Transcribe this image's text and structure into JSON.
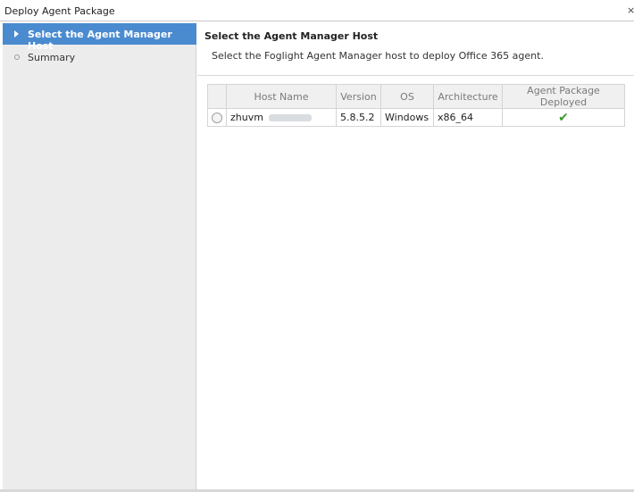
{
  "window": {
    "title": "Deploy Agent Package",
    "close_glyph": "×"
  },
  "steps": [
    {
      "label": "Select the Agent Manager Host",
      "active": true
    },
    {
      "label": "Summary",
      "active": false
    }
  ],
  "main": {
    "title": "Select the Agent Manager Host",
    "description": "Select the Foglight Agent Manager host to deploy Office 365 agent."
  },
  "table": {
    "columns": [
      "Host Name",
      "Version",
      "OS",
      "Architecture",
      "Agent Package Deployed"
    ],
    "rows": [
      {
        "host": "zhuvm",
        "version": "5.8.5.2",
        "os": "Windows",
        "arch": "x86_64",
        "deployed_icon": "✔"
      }
    ]
  },
  "icons": {
    "active_step": "triangle-right-icon",
    "inactive_step": "circle-bullet-icon",
    "deployed": "green-check-icon",
    "row_select": "radio-button"
  },
  "colors": {
    "accent": "#4a8bd0",
    "sidebar_bg": "#ececec",
    "check_green": "#3f9a2f"
  }
}
